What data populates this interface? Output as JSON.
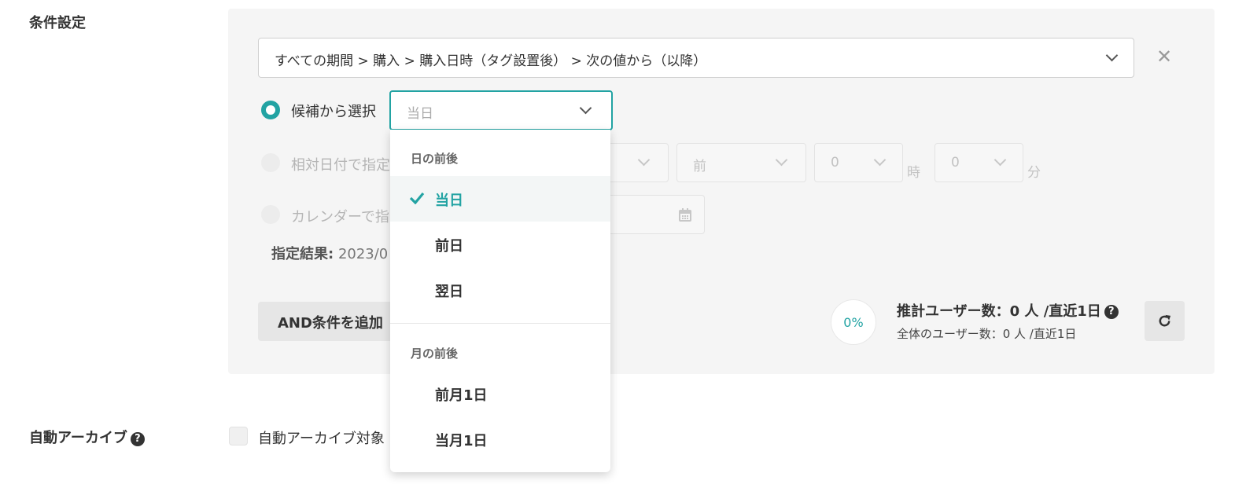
{
  "labels": {
    "condition_settings": "条件設定",
    "auto_archive": "自動アーカイブ"
  },
  "condition": {
    "path": "すべての期間 > 購入 > 購入日時（タグ設置後） > 次の値から（以降）",
    "close": "✕"
  },
  "modes": {
    "candidate": "候補から選択",
    "relative": "相対日付で指定",
    "calendar": "カレンダーで指"
  },
  "candidate_select": {
    "value": "当日"
  },
  "relative_fields": {
    "direction": "前",
    "hour_value": "0",
    "hour_unit": "時",
    "minute_value": "0",
    "minute_unit": "分"
  },
  "result": {
    "label": "指定結果:",
    "value": "2023/0"
  },
  "buttons": {
    "add_and": "AND条件を追加"
  },
  "estimate": {
    "percent": "0%",
    "main": "推計ユーザー数：0 人 /直近1日",
    "sub": "全体のユーザー数：0 人 /直近1日"
  },
  "auto_archive": {
    "checkbox_label": "自動アーカイブ対象"
  },
  "dropdown": {
    "group1": "日の前後",
    "options1": [
      "当日",
      "前日",
      "翌日"
    ],
    "group2": "月の前後",
    "options2": [
      "前月1日",
      "当月1日"
    ],
    "selected": "当日"
  },
  "colors": {
    "accent": "#22a3a3"
  }
}
